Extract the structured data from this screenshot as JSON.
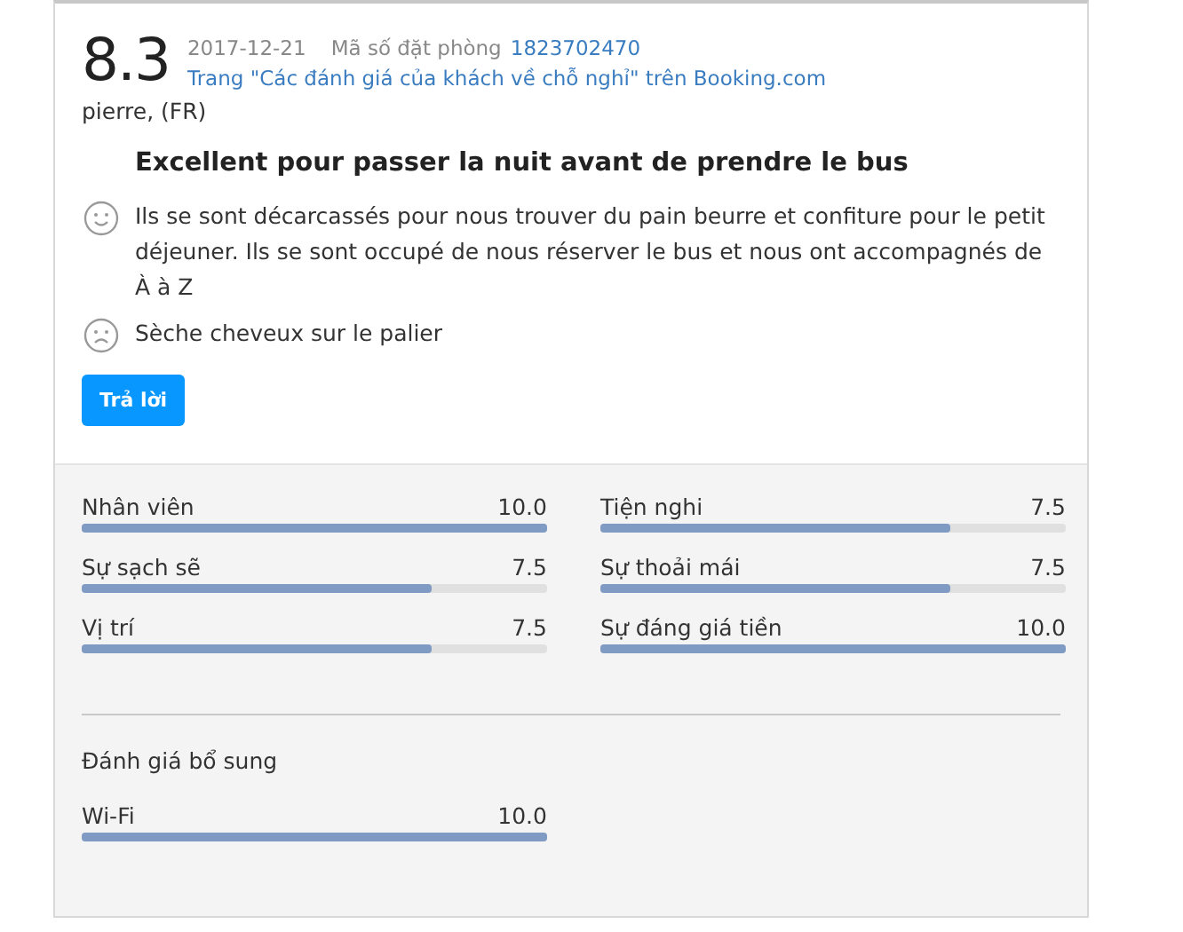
{
  "review": {
    "score": "8.3",
    "date": "2017-12-21",
    "booking_label": "Mã số đặt phòng",
    "booking_number": "1823702470",
    "source_link": "Trang \"Các đánh giá của khách về chỗ nghỉ\" trên Booking.com",
    "reviewer": "pierre, (FR)",
    "title": "Excellent pour passer la nuit avant de prendre le bus",
    "comments": [
      {
        "kind": "positive",
        "text": "Ils se sont décarcassés pour nous trouver du pain beurre et confiture pour le petit déjeuner. Ils se sont occupé de nous réserver le bus et nous ont accompagnés de À à Z"
      },
      {
        "kind": "negative",
        "text": "Sèche cheveux sur le palier"
      }
    ],
    "reply_button": "Trả lời"
  },
  "ratings": [
    {
      "label": "Nhân viên",
      "reading": "10.0",
      "level": 1
    },
    {
      "label": "Tiện nghi",
      "reading": "7.5",
      "level": 0.75
    },
    {
      "label": "Sự sạch sẽ",
      "reading": "7.5",
      "level": 0.75
    },
    {
      "label": "Sự thoải mái",
      "reading": "7.5",
      "level": 0.75
    },
    {
      "label": "Vị trí",
      "reading": "7.5",
      "level": 0.75
    },
    {
      "label": "Sự đáng giá tiền",
      "reading": "10.0",
      "level": 1
    }
  ],
  "additional": {
    "heading": "Đánh giá bổ sung",
    "ratings": [
      {
        "label": "Wi-Fi",
        "reading": "10.0",
        "level": 1
      }
    ]
  }
}
